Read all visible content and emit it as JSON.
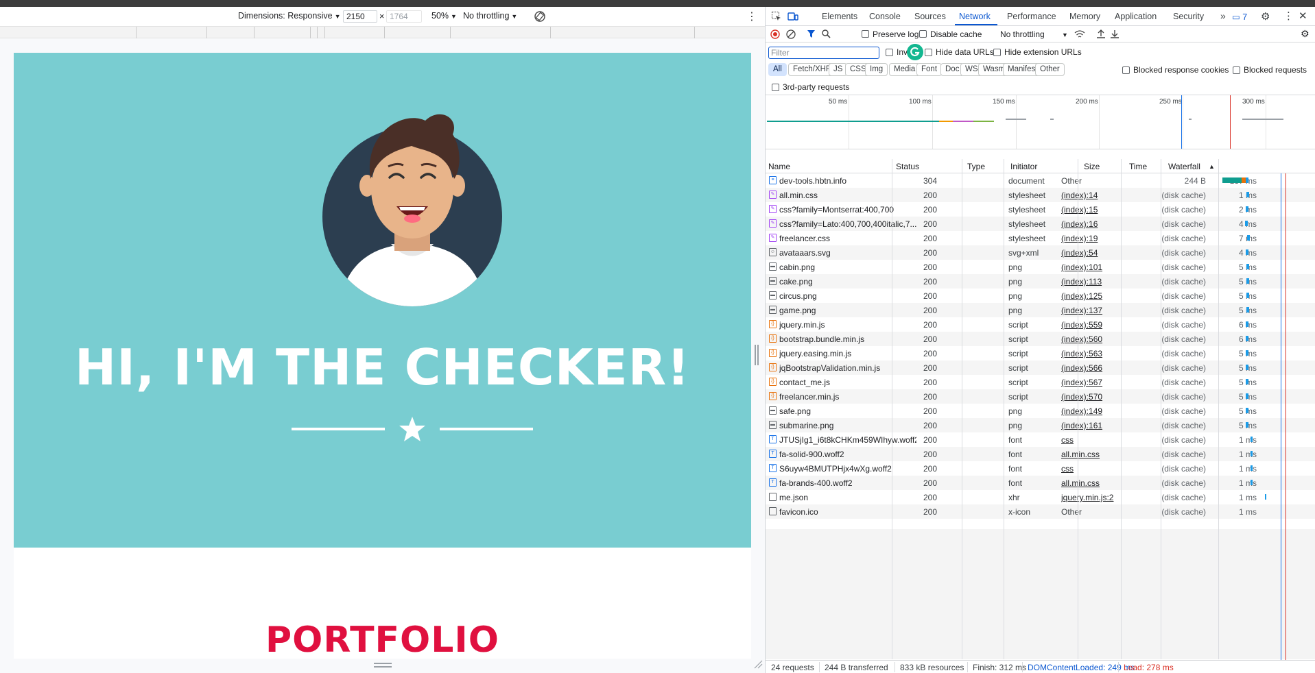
{
  "emulation": {
    "dimensions_label": "Dimensions: Responsive",
    "width": "2150",
    "times": "×",
    "height_placeholder": "1764",
    "zoom": "50%",
    "throttling": "No throttling"
  },
  "page": {
    "hero_title": "HI, I'M THE CHECKER!",
    "section_title": "PORTFOLIO"
  },
  "devtools": {
    "tabs": [
      "Elements",
      "Console",
      "Sources",
      "Network",
      "Performance",
      "Memory",
      "Application",
      "Security"
    ],
    "active_tab": "Network",
    "more_tabs": "»",
    "issues_count": "7",
    "toolbar": {
      "preserve_log": "Preserve log",
      "disable_cache": "Disable cache",
      "throttling": "No throttling"
    },
    "filter": {
      "placeholder": "Filter",
      "invert": "Inv",
      "hide_data_urls": "Hide data URLs",
      "hide_extension_urls": "Hide extension URLs",
      "blocked_response_cookies": "Blocked response cookies",
      "blocked_requests": "Blocked requests",
      "third_party": "3rd-party requests"
    },
    "type_chips": [
      "All",
      "Fetch/XHR",
      "JS",
      "CSS",
      "Img",
      "Media",
      "Font",
      "Doc",
      "WS",
      "Wasm",
      "Manifest",
      "Other"
    ],
    "overview_ticks": [
      "50 ms",
      "100 ms",
      "150 ms",
      "200 ms",
      "250 ms",
      "300 ms"
    ],
    "columns": {
      "name": "Name",
      "status": "Status",
      "type": "Type",
      "initiator": "Initiator",
      "size": "Size",
      "time": "Time",
      "waterfall": "Waterfall"
    },
    "requests": [
      {
        "name": "dev-tools.hbtn.info",
        "status": "304",
        "type": "document",
        "initiator": "Other",
        "size": "244 B",
        "time": "137 ms",
        "kind": "doc"
      },
      {
        "name": "all.min.css",
        "status": "200",
        "type": "stylesheet",
        "initiator": "(index):14",
        "size": "(disk cache)",
        "time": "1 ms",
        "kind": "css"
      },
      {
        "name": "css?family=Montserrat:400,700",
        "status": "200",
        "type": "stylesheet",
        "initiator": "(index):15",
        "size": "(disk cache)",
        "time": "2 ms",
        "kind": "css"
      },
      {
        "name": "css?family=Lato:400,700,400italic,7...",
        "status": "200",
        "type": "stylesheet",
        "initiator": "(index):16",
        "size": "(disk cache)",
        "time": "4 ms",
        "kind": "css"
      },
      {
        "name": "freelancer.css",
        "status": "200",
        "type": "stylesheet",
        "initiator": "(index):19",
        "size": "(disk cache)",
        "time": "7 ms",
        "kind": "css"
      },
      {
        "name": "avataaars.svg",
        "status": "200",
        "type": "svg+xml",
        "initiator": "(index):54",
        "size": "(disk cache)",
        "time": "4 ms",
        "kind": "svg"
      },
      {
        "name": "cabin.png",
        "status": "200",
        "type": "png",
        "initiator": "(index):101",
        "size": "(disk cache)",
        "time": "5 ms",
        "kind": "img"
      },
      {
        "name": "cake.png",
        "status": "200",
        "type": "png",
        "initiator": "(index):113",
        "size": "(disk cache)",
        "time": "5 ms",
        "kind": "img"
      },
      {
        "name": "circus.png",
        "status": "200",
        "type": "png",
        "initiator": "(index):125",
        "size": "(disk cache)",
        "time": "5 ms",
        "kind": "img"
      },
      {
        "name": "game.png",
        "status": "200",
        "type": "png",
        "initiator": "(index):137",
        "size": "(disk cache)",
        "time": "5 ms",
        "kind": "img"
      },
      {
        "name": "jquery.min.js",
        "status": "200",
        "type": "script",
        "initiator": "(index):559",
        "size": "(disk cache)",
        "time": "6 ms",
        "kind": "js"
      },
      {
        "name": "bootstrap.bundle.min.js",
        "status": "200",
        "type": "script",
        "initiator": "(index):560",
        "size": "(disk cache)",
        "time": "6 ms",
        "kind": "js"
      },
      {
        "name": "jquery.easing.min.js",
        "status": "200",
        "type": "script",
        "initiator": "(index):563",
        "size": "(disk cache)",
        "time": "5 ms",
        "kind": "js"
      },
      {
        "name": "jqBootstrapValidation.min.js",
        "status": "200",
        "type": "script",
        "initiator": "(index):566",
        "size": "(disk cache)",
        "time": "5 ms",
        "kind": "js"
      },
      {
        "name": "contact_me.js",
        "status": "200",
        "type": "script",
        "initiator": "(index):567",
        "size": "(disk cache)",
        "time": "5 ms",
        "kind": "js"
      },
      {
        "name": "freelancer.min.js",
        "status": "200",
        "type": "script",
        "initiator": "(index):570",
        "size": "(disk cache)",
        "time": "5 ms",
        "kind": "js"
      },
      {
        "name": "safe.png",
        "status": "200",
        "type": "png",
        "initiator": "(index):149",
        "size": "(disk cache)",
        "time": "5 ms",
        "kind": "img"
      },
      {
        "name": "submarine.png",
        "status": "200",
        "type": "png",
        "initiator": "(index):161",
        "size": "(disk cache)",
        "time": "5 ms",
        "kind": "img"
      },
      {
        "name": "JTUSjIg1_i6t8kCHKm459WIhyw.woff2",
        "status": "200",
        "type": "font",
        "initiator": "css",
        "size": "(disk cache)",
        "time": "1 ms",
        "kind": "font"
      },
      {
        "name": "fa-solid-900.woff2",
        "status": "200",
        "type": "font",
        "initiator": "all.min.css",
        "size": "(disk cache)",
        "time": "1 ms",
        "kind": "font"
      },
      {
        "name": "S6uyw4BMUTPHjx4wXg.woff2",
        "status": "200",
        "type": "font",
        "initiator": "css",
        "size": "(disk cache)",
        "time": "1 ms",
        "kind": "font"
      },
      {
        "name": "fa-brands-400.woff2",
        "status": "200",
        "type": "font",
        "initiator": "all.min.css",
        "size": "(disk cache)",
        "time": "1 ms",
        "kind": "font"
      },
      {
        "name": "me.json",
        "status": "200",
        "type": "xhr",
        "initiator": "jquery.min.js:2",
        "size": "(disk cache)",
        "time": "1 ms",
        "kind": "xhr"
      },
      {
        "name": "favicon.ico",
        "status": "200",
        "type": "x-icon",
        "initiator": "Other",
        "size": "(disk cache)",
        "time": "1 ms",
        "kind": "other"
      }
    ],
    "summary": {
      "requests": "24 requests",
      "transferred": "244 B transferred",
      "resources": "833 kB resources",
      "finish": "Finish: 312 ms",
      "dom_content_loaded": "DOMContentLoaded: 249 ms",
      "load": "Load: 278 ms"
    },
    "colors": {
      "accent": "#0b57d0",
      "dcl": "#1a73e8",
      "load": "#d93025",
      "waiting": "#0f9d8f",
      "download": "#1a9be8"
    }
  }
}
